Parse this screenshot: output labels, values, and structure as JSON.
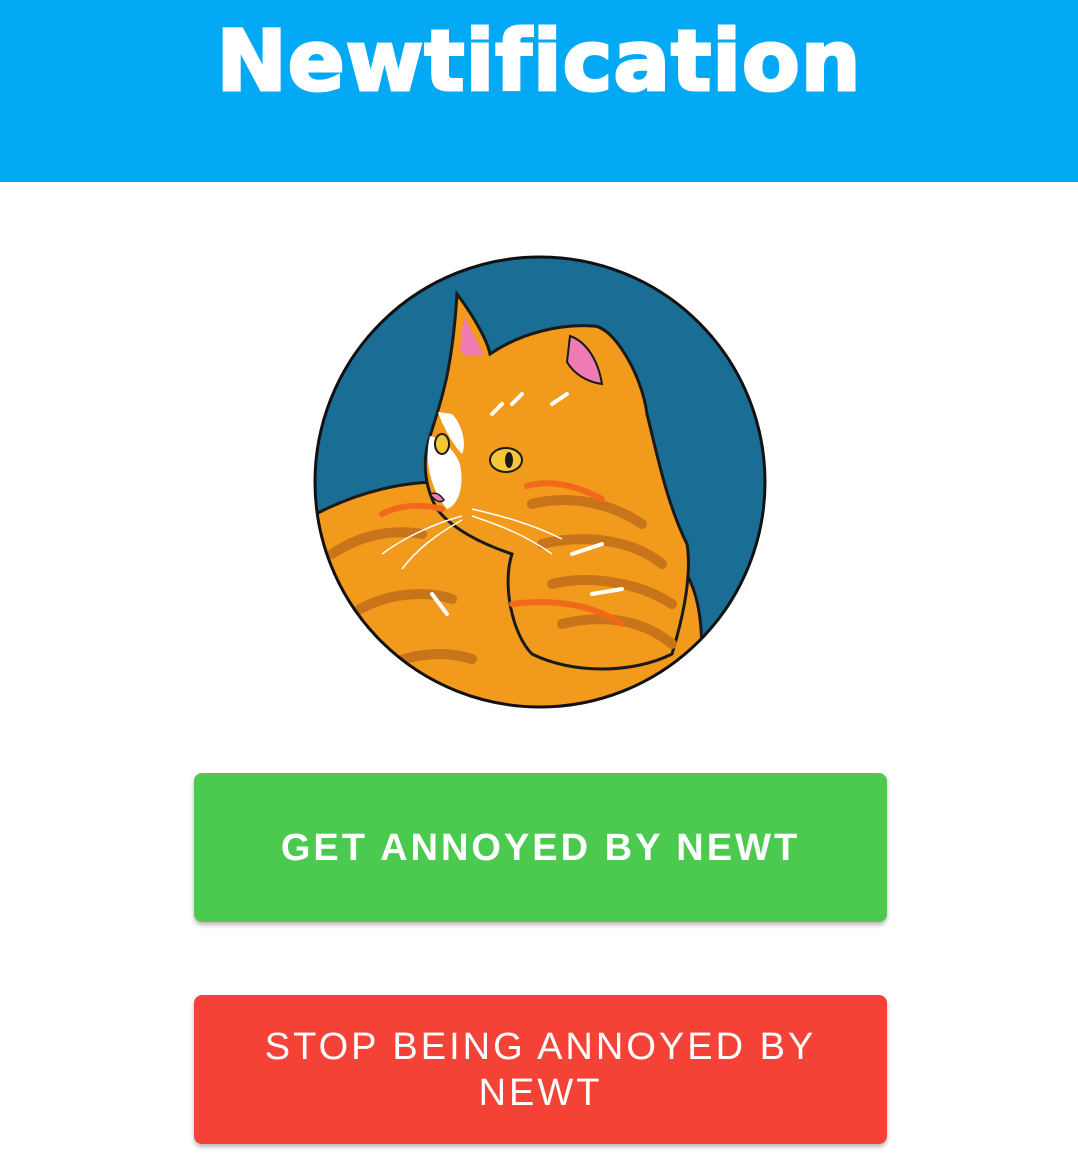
{
  "header": {
    "title": "Newtification"
  },
  "avatar": {
    "icon": "cat-icon",
    "ring_color": "#1a6e96",
    "fur_color": "#f29a1c"
  },
  "buttons": {
    "get_annoyed_label": "GET ANNOYED BY NEWT",
    "stop_annoyed_label": "STOP BEING ANNOYED BY NEWT"
  },
  "colors": {
    "header": "#03a9f4",
    "get_button": "#4cc94f",
    "stop_button": "#f44336"
  }
}
